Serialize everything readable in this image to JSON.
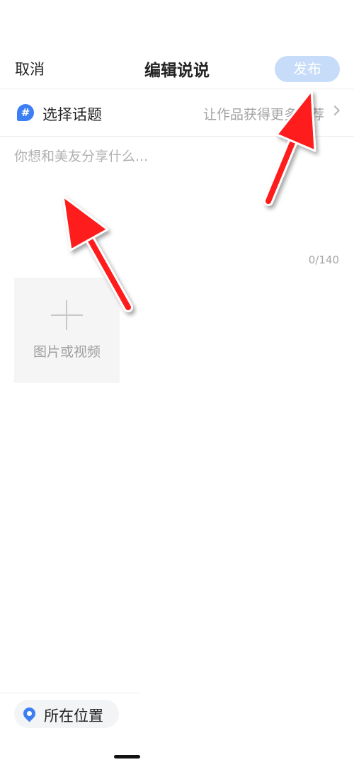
{
  "header": {
    "cancel_label": "取消",
    "title": "编辑说说",
    "publish_label": "发布"
  },
  "topic": {
    "icon": "hash-icon",
    "label": "选择话题",
    "hint": "让作品获得更多推荐"
  },
  "composer": {
    "placeholder": "你想和美友分享什么...",
    "value": "",
    "counter": "0/140"
  },
  "media": {
    "icon": "plus-icon",
    "label": "图片或视频"
  },
  "location": {
    "icon": "location-pin-icon",
    "label": "所在位置"
  },
  "colors": {
    "accent": "#3d7ef5",
    "publish_disabled_bg": "#c6dcf8",
    "annotation_arrow": "#ff1a1a"
  }
}
